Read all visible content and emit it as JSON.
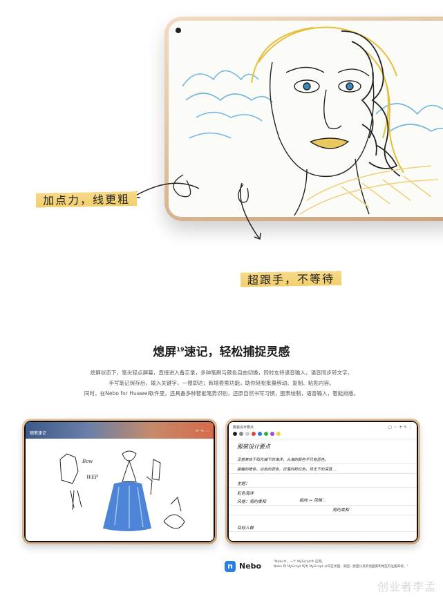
{
  "hero": {
    "callout_pressure": "加点力，线更粗",
    "callout_follow": "超跟手，不等待"
  },
  "section": {
    "title_main": "熄屏",
    "title_sup": "19",
    "title_rest": "速记，轻松捕捉灵感",
    "desc_lines": [
      "熄屏状态下，笔尖轻点屏幕，直接进入备忘录，多种笔刷与颜色自由切换，同时支持语音输入，语音同步转文字，",
      "手写笔记保存后，输入关键字，一搜即达；新增套索功能，助你轻松批量移动、复制、粘贴内容。",
      "同时，在Nebo for Huawei软件里，还具备多种智能笔势识别，还原自然书写习惯，图表绘制，语音输入，智能排版。"
    ]
  },
  "left_tablet": {
    "app_title": "随笔速记",
    "sketch_note_1": "Bow",
    "sketch_note_2": "WEP"
  },
  "right_tablet": {
    "doc_title": "服装设计要点",
    "lines": [
      "服装设计要点",
      "灵感来自于阳光铺下的海洋，大海的颜色不只有蓝色，",
      "晨曦的橙色，白色的蓝色，日落的粉红色，月光下的深蓝…",
      "主题：",
      "彩色海洋",
      "风格：简约柔和",
      "指向 →  风格：",
      "简约柔和",
      "目标人群"
    ]
  },
  "footer": {
    "logo_letter": "n",
    "brand": "Nebo",
    "note_line1": "\"Nebo®，一个 MyScript® 应用。",
    "note_line2": "Nebo 和 MyScript 均为 MyScript 公司在中国、美国、欧盟以及其他国家和地区的注册商标。\"",
    "watermark": "创业者李孟"
  },
  "colors": {
    "gold": "#d9b793",
    "highlight": "#f2cf6c",
    "nebo_blue": "#2a7de1"
  }
}
